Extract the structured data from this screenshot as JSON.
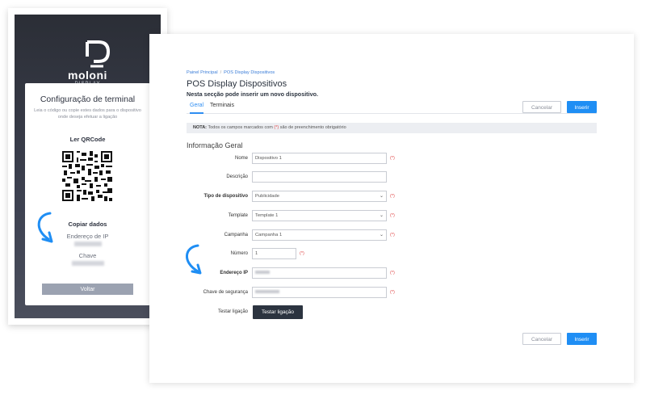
{
  "phone": {
    "logo": {
      "brand": "moloni",
      "sub": "DISPLAY"
    },
    "title": "Configuração de terminal",
    "description": "Leia o código ou copie estes dados para o dispositivo onde deseja efetuar a ligação",
    "qr_title": "Ler QRCode",
    "copy_title": "Copiar dados",
    "ip_label": "Endereço de IP",
    "key_label": "Chave",
    "back_label": "Voltar"
  },
  "page": {
    "breadcrumb": [
      "Painel Principal",
      "POS Display Dispositivos"
    ],
    "title": "POS Display Dispositivos",
    "subtitle": "Nesta secção pode inserir um novo dispositivo.",
    "tabs": [
      "Geral",
      "Terminais"
    ],
    "cancel_label": "Cancelar",
    "insert_label": "Inserir",
    "note": {
      "prefix": "NOTA:",
      "text_before": "Todos os campos marcados com",
      "req": "(*)",
      "text_after": "são de preenchimento obrigatório"
    },
    "section_title": "Informação Geral",
    "fields": {
      "nome": {
        "label": "Nome",
        "value": "Dispositivo 1",
        "req": "(*)"
      },
      "descricao": {
        "label": "Descrição",
        "value": ""
      },
      "tipo": {
        "label": "Tipo de dispositivo",
        "value": "Publicidade",
        "req": "(*)"
      },
      "template": {
        "label": "Template",
        "value": "Template 1",
        "req": "(*)"
      },
      "campanha": {
        "label": "Campanha",
        "value": "Campanha 1",
        "req": "(*)"
      },
      "numero": {
        "label": "Número",
        "value": "1",
        "req": "(*)"
      },
      "ip": {
        "label": "Endereço IP",
        "req": "(*)"
      },
      "chave": {
        "label": "Chave de segurança",
        "req": "(*)"
      }
    },
    "test_label": "Testar ligação",
    "test_button": "Testar ligação"
  },
  "colors": {
    "accent": "#1f8ef4",
    "dark": "#2c3440",
    "required": "#e04a4a",
    "phone_bg": "#2b2e36"
  },
  "icons": [
    "moloni-logo-icon",
    "qr-code-icon",
    "curved-arrow-icon",
    "chevron-down-icon"
  ]
}
